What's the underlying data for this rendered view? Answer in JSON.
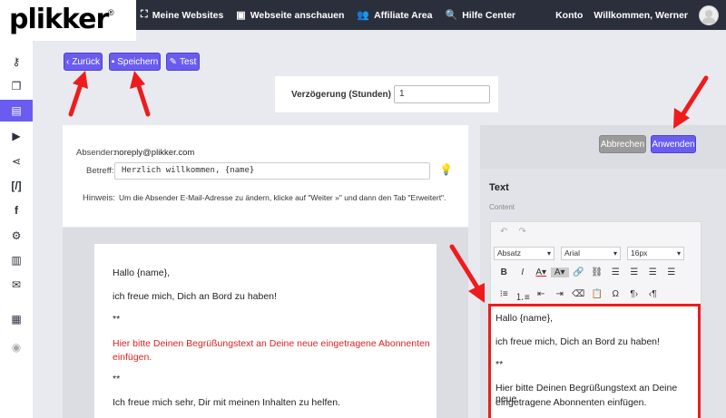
{
  "logo": {
    "text": "plikker",
    "reg": "®"
  },
  "nav": {
    "items": [
      {
        "label": "Meine Websites",
        "icon": "sitemap-icon"
      },
      {
        "label": "Webseite anschauen",
        "icon": "monitor-icon"
      },
      {
        "label": "Affiliate Area",
        "icon": "users-icon"
      },
      {
        "label": "Hilfe Center",
        "icon": "search-icon"
      }
    ],
    "account": "Konto",
    "welcome": "Willkommen, Werner"
  },
  "sidebar": {
    "icons": [
      "key-icon",
      "pages-icon",
      "newsletter-icon",
      "video-icon",
      "share-icon",
      "code-icon",
      "facebook-icon",
      "gear-icon",
      "chart-icon",
      "mail-icon",
      "id-card-icon",
      "play-circle-icon"
    ],
    "active_index": 2
  },
  "actions": {
    "back": "Zurück",
    "save": "Speichern",
    "test": "Test"
  },
  "delay": {
    "label": "Verzögerung (Stunden)",
    "value": "1"
  },
  "sender": {
    "from_label": "Absender:",
    "from_value": "noreply@plikker.com",
    "subject_label": "Betreff:",
    "subject_value": "Herzlich willkommen, {name}",
    "hint_label": "Hinweis:",
    "hint_text": "Um die Absender E-Mail-Adresse zu ändern, klicke auf \"Weiter »\" und dann den Tab \"Erweitert\"."
  },
  "email": {
    "greeting": "Hallo {name},",
    "line1": "ich freue mich, Dich an Bord zu haben!",
    "stars1": "**",
    "red_line1": "Hier bitte Deinen Begrüßungstext an Deine neue eingetragene Abonnenten",
    "red_line2": "einfügen.",
    "stars2": "**",
    "line2": "Ich freue mich sehr, Dir mit meinen Inhalten zu helfen."
  },
  "right_panel": {
    "cancel": "Abbrechen",
    "apply": "Anwenden",
    "heading": "Text",
    "content_label": "Content",
    "format": "Absatz",
    "font": "Arial",
    "size": "16px",
    "preview": {
      "greeting": "Hallo {name},",
      "line1": "ich freue mich, Dich an Bord zu haben!",
      "stars": "**",
      "red_line1": "Hier bitte Deinen Begrüßungstext an Deine neue",
      "red_line2": "eingetragene Abonnenten einfügen."
    }
  },
  "colors": {
    "accent": "#6a5cf0",
    "highlight": "#ee1c1c",
    "topbar": "#2b2f3c"
  }
}
